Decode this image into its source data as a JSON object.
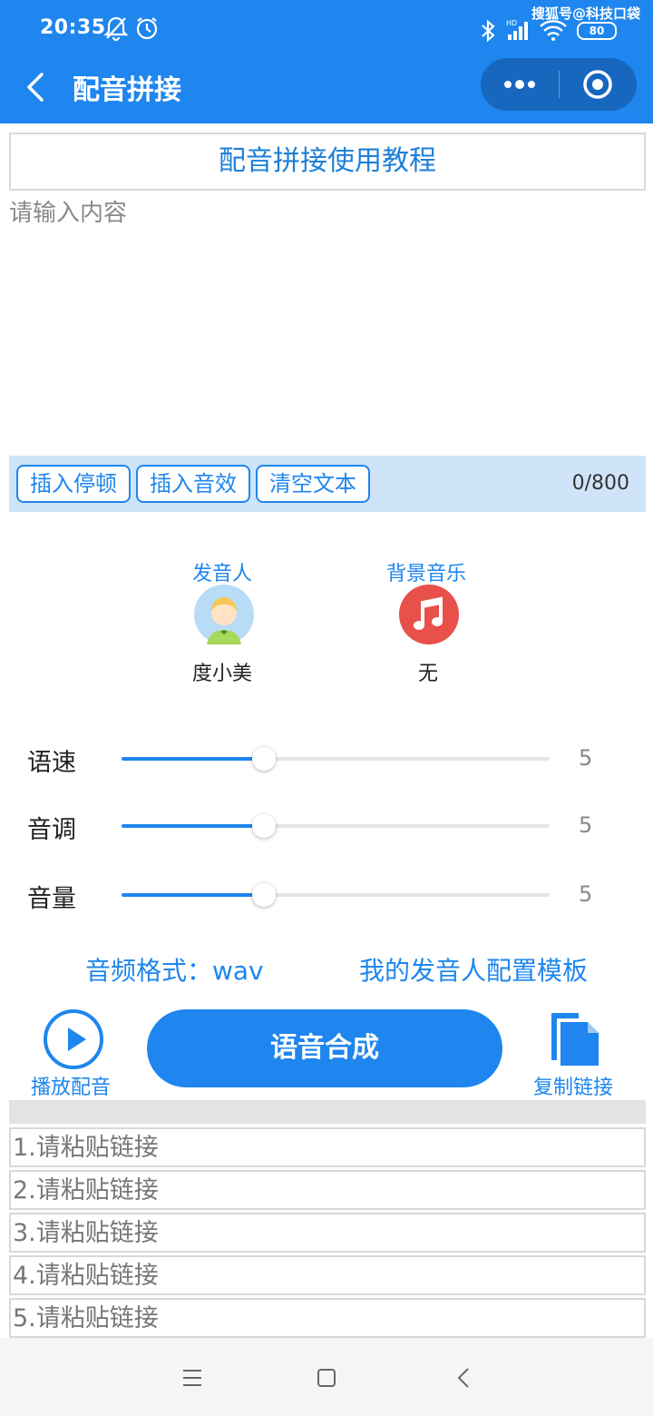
{
  "status_bar": {
    "time": "20:35",
    "watermark": "搜狐号@科技口袋",
    "battery": "80",
    "network_label": "HD"
  },
  "header": {
    "title": "配音拼接",
    "menu_icon": "more-dots-icon",
    "close_icon": "target-circle-icon"
  },
  "tutorial_button": "配音拼接使用教程",
  "text_input": {
    "placeholder": "请输入内容",
    "value": ""
  },
  "toolbar": {
    "insert_pause": "插入停顿",
    "insert_effect": "插入音效",
    "clear_text": "清空文本",
    "counter": "0/800"
  },
  "speaker": {
    "label": "发音人",
    "value": "度小美"
  },
  "music": {
    "label": "背景音乐",
    "value": "无"
  },
  "sliders": [
    {
      "label": "语速",
      "value": "5",
      "fraction": 0.333
    },
    {
      "label": "音调",
      "value": "5",
      "fraction": 0.333
    },
    {
      "label": "音量",
      "value": "5",
      "fraction": 0.333
    }
  ],
  "audio_format": "音频格式：wav",
  "template_link": "我的发音人配置模板",
  "actions": {
    "play_label": "播放配音",
    "synthesize": "语音合成",
    "copy_label": "复制链接"
  },
  "link_inputs": [
    "1.请粘贴链接",
    "2.请粘贴链接",
    "3.请粘贴链接",
    "4.请粘贴链接",
    "5.请粘贴链接"
  ],
  "colors": {
    "primary": "#1e86ee",
    "toolbar_bg": "#cfe4f8",
    "music_icon": "#e8514a",
    "avatar_bg": "#b8dcf5"
  }
}
